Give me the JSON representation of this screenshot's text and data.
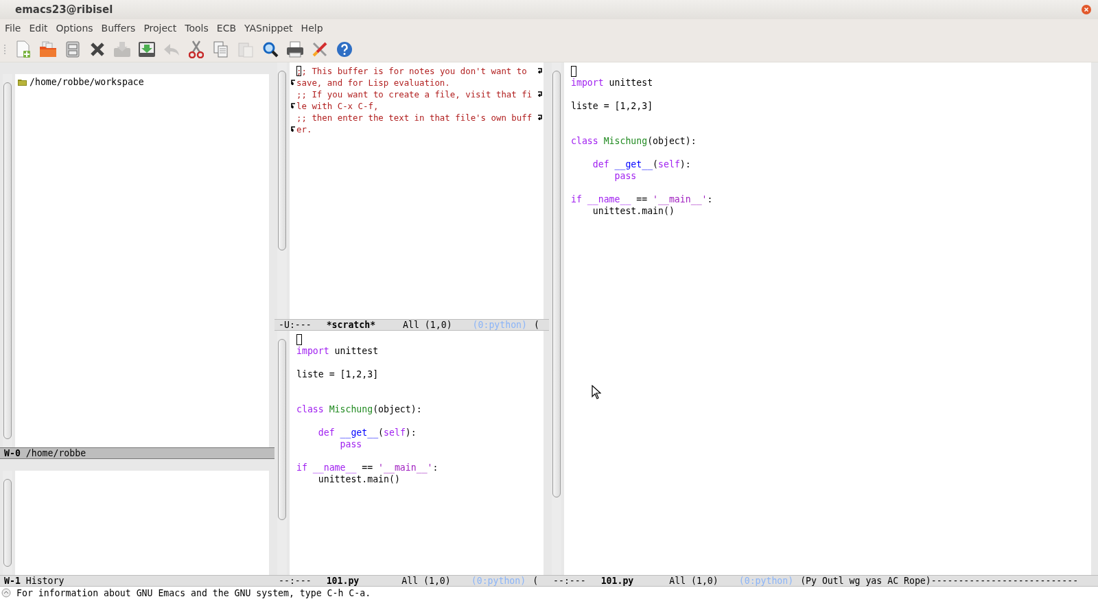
{
  "window": {
    "title": "emacs23@ribisel"
  },
  "menu": [
    "File",
    "Edit",
    "Options",
    "Buffers",
    "Project",
    "Tools",
    "ECB",
    "YASnippet",
    "Help"
  ],
  "toolbar": [
    {
      "disabled": false
    },
    {
      "disabled": false
    },
    {
      "disabled": false
    },
    {
      "disabled": false
    },
    {
      "disabled": true
    },
    {
      "disabled": false
    },
    {
      "disabled": true
    },
    {
      "disabled": false
    },
    {
      "disabled": false
    },
    {
      "disabled": true
    },
    {
      "disabled": false
    },
    {
      "disabled": false
    },
    {
      "disabled": false
    },
    {
      "disabled": false
    }
  ],
  "ecb": {
    "directories": [
      {
        "label": "/home/robbe/workspace"
      }
    ],
    "directories_modeline": {
      "window": "W-0",
      "label": "/home/robbe"
    },
    "history_modeline": {
      "window": "W-1",
      "label": "History"
    }
  },
  "scratch": {
    "lines": [
      {
        "text": ";; This buffer is for notes you don't want to",
        "cursor": true,
        "wrap_start": false,
        "wrap_end": true
      },
      {
        "text": "save, and for Lisp evaluation.",
        "cursor": false,
        "wrap_start": true,
        "wrap_end": false
      },
      {
        "text": ";; If you want to create a file, visit that fi",
        "cursor": false,
        "wrap_start": false,
        "wrap_end": true
      },
      {
        "text": "le with C-x C-f,",
        "cursor": false,
        "wrap_start": true,
        "wrap_end": false
      },
      {
        "text": ";; then enter the text in that file's own buff",
        "cursor": false,
        "wrap_start": false,
        "wrap_end": true
      },
      {
        "text": "er.",
        "cursor": false,
        "wrap_start": true,
        "wrap_end": false
      }
    ],
    "modeline": {
      "status": "-U:---",
      "buffer": "*scratch*",
      "position": "All (1,0)",
      "modes": "(0:python)",
      "rest": "("
    }
  },
  "editor_bottom": {
    "lines": [
      {
        "kind": "cursor"
      },
      {
        "kind": "code",
        "tokens": [
          {
            "text": "import",
            "kind": "keyword"
          },
          {
            "text": " unittest",
            "kind": "plain"
          }
        ]
      },
      {
        "kind": "blank"
      },
      {
        "kind": "code",
        "tokens": [
          {
            "text": "liste = [1,2,3]",
            "kind": "plain"
          }
        ]
      },
      {
        "kind": "blank"
      },
      {
        "kind": "blank"
      },
      {
        "kind": "code",
        "tokens": [
          {
            "text": "class ",
            "kind": "keyword"
          },
          {
            "text": "Mischung",
            "kind": "type"
          },
          {
            "text": "(object):",
            "kind": "plain"
          }
        ]
      },
      {
        "kind": "blank"
      },
      {
        "kind": "code",
        "tokens": [
          {
            "text": "    def ",
            "kind": "keyword"
          },
          {
            "text": "__get__",
            "kind": "function"
          },
          {
            "text": "(",
            "kind": "plain"
          },
          {
            "text": "self",
            "kind": "keyword"
          },
          {
            "text": "):",
            "kind": "plain"
          }
        ]
      },
      {
        "kind": "code",
        "tokens": [
          {
            "text": "        pass",
            "kind": "keyword"
          }
        ]
      },
      {
        "kind": "blank"
      },
      {
        "kind": "code",
        "tokens": [
          {
            "text": "if __name__",
            "kind": "keyword"
          },
          {
            "text": " == ",
            "kind": "plain"
          },
          {
            "text": "'__main__'",
            "kind": "string"
          },
          {
            "text": ":",
            "kind": "plain"
          }
        ]
      },
      {
        "kind": "code",
        "tokens": [
          {
            "text": "    unittest.main()",
            "kind": "plain"
          }
        ]
      }
    ],
    "modeline": {
      "status": "--:---",
      "buffer": "101.py",
      "position": "All (1,0)",
      "modes": "(0:python)",
      "rest": "("
    }
  },
  "editor_right": {
    "lines": [
      {
        "kind": "cursor"
      },
      {
        "kind": "code",
        "tokens": [
          {
            "text": "import",
            "kind": "keyword"
          },
          {
            "text": " unittest",
            "kind": "plain"
          }
        ]
      },
      {
        "kind": "blank"
      },
      {
        "kind": "code",
        "tokens": [
          {
            "text": "liste = [1,2,3]",
            "kind": "plain"
          }
        ]
      },
      {
        "kind": "blank"
      },
      {
        "kind": "blank"
      },
      {
        "kind": "code",
        "tokens": [
          {
            "text": "class ",
            "kind": "keyword"
          },
          {
            "text": "Mischung",
            "kind": "type"
          },
          {
            "text": "(object):",
            "kind": "plain"
          }
        ]
      },
      {
        "kind": "blank"
      },
      {
        "kind": "code",
        "tokens": [
          {
            "text": "    def ",
            "kind": "keyword"
          },
          {
            "text": "__get__",
            "kind": "function"
          },
          {
            "text": "(",
            "kind": "plain"
          },
          {
            "text": "self",
            "kind": "keyword"
          },
          {
            "text": "):",
            "kind": "plain"
          }
        ]
      },
      {
        "kind": "code",
        "tokens": [
          {
            "text": "        pass",
            "kind": "keyword"
          }
        ]
      },
      {
        "kind": "blank"
      },
      {
        "kind": "code",
        "tokens": [
          {
            "text": "if __name__",
            "kind": "keyword"
          },
          {
            "text": " == ",
            "kind": "plain"
          },
          {
            "text": "'__main__'",
            "kind": "string"
          },
          {
            "text": ":",
            "kind": "plain"
          }
        ]
      },
      {
        "kind": "code",
        "tokens": [
          {
            "text": "    unittest.main()",
            "kind": "plain"
          }
        ]
      }
    ],
    "modeline": {
      "status": "--:---",
      "buffer": "101.py",
      "position": "All (1,0)",
      "modes": "(0:python)",
      "rest": "(Py Outl wg yas AC Rope)---------------------------"
    }
  },
  "echo_area": "For information about GNU Emacs and the GNU system, type C-h C-a."
}
